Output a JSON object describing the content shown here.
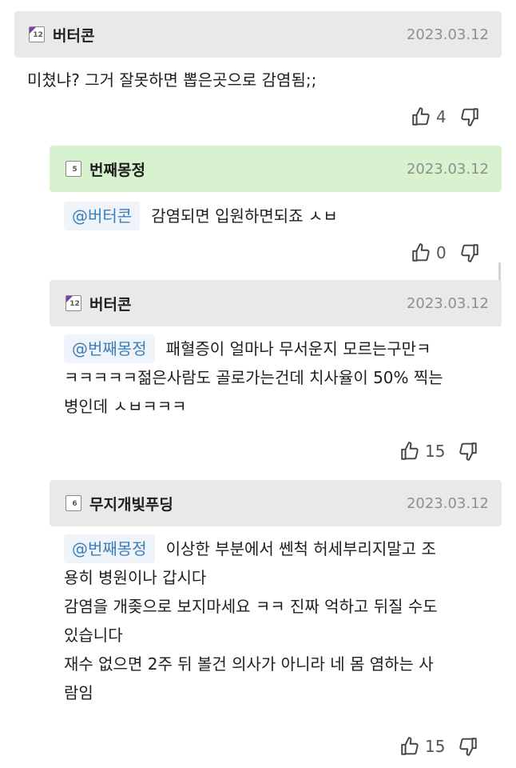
{
  "comments": [
    {
      "level": "12",
      "user": "버터콘",
      "date": "2023.03.12",
      "mention": "",
      "lines": [
        "미쳤냐? 그거 잘못하면 뽑은곳으로 감염됨;;"
      ],
      "likes": "4"
    },
    {
      "level": "5",
      "user": "번째몽정",
      "date": "2023.03.12",
      "mention": "@버터콘",
      "lines": [
        "감염되면 입원하면되죠 ㅅㅂ"
      ],
      "likes": "0"
    },
    {
      "level": "12",
      "user": "버터콘",
      "date": "2023.03.12",
      "mention": "@번째몽정",
      "lines": [
        "패혈증이 얼마나 무서운지 모르는구만ㅋ",
        "ㅋㅋㅋㅋㅋ젊은사람도 골로가는건데 치사율이 50% 찍는",
        "병인데 ㅅㅂㅋㅋㅋ"
      ],
      "likes": "15"
    },
    {
      "level": "6",
      "user": "무지개빛푸딩",
      "date": "2023.03.12",
      "mention": "@번째몽정",
      "lines": [
        "이상한 부분에서 쎈척 허세부리지말고 조",
        "용히 병원이나 갑시다",
        "감염을 개좆으로 보지마세요 ㅋㅋ 진짜 억하고 뒤질 수도",
        "있습니다",
        "재수 없으면 2주 뒤 볼건 의사가 아니라 네 몸 염하는 사",
        "람임"
      ],
      "likes": "15"
    }
  ],
  "icons": {
    "like": "thumbs-up-icon",
    "dislike": "thumbs-down-icon",
    "level": "level-badge-icon"
  },
  "colors": {
    "header_bg": "#e9e9e9",
    "highlight_header_bg": "#d8f1ce",
    "mention_text": "#3c7eb8",
    "mention_bg": "#eef4f9",
    "level_badge_accent": "#7a3fb0"
  }
}
